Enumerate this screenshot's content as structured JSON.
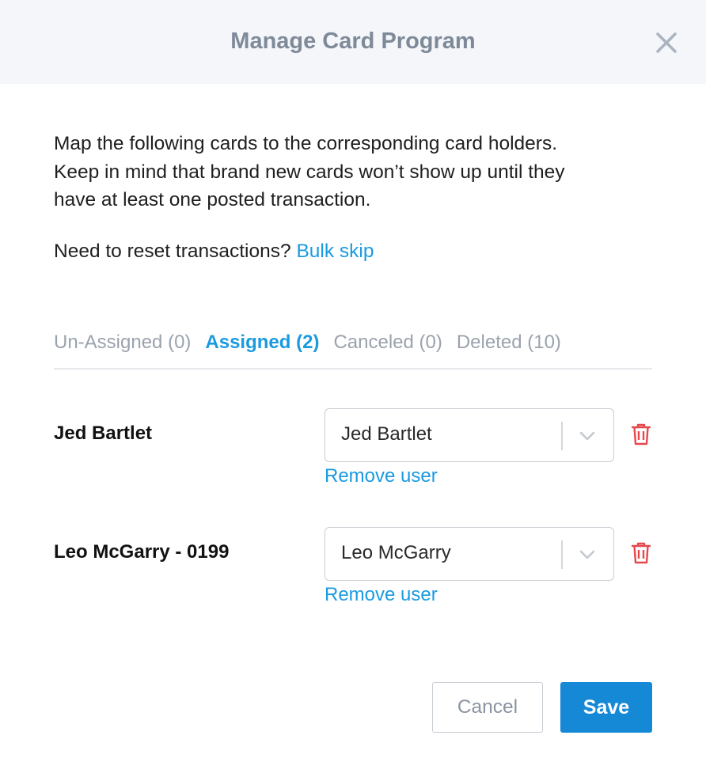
{
  "header": {
    "title": "Manage Card Program",
    "close_icon": "close-icon"
  },
  "intro": {
    "line1": "Map the following cards to the corresponding card holders.",
    "line2": "Keep in mind that brand new cards won’t show up until they",
    "line3": "have at least one posted transaction."
  },
  "reset": {
    "question": "Need to reset transactions?",
    "link": "Bulk skip"
  },
  "tabs": [
    {
      "label": "Un-Assigned (0)",
      "active": false
    },
    {
      "label": "Assigned (2)",
      "active": true
    },
    {
      "label": "Canceled (0)",
      "active": false
    },
    {
      "label": "Deleted (10)",
      "active": false
    }
  ],
  "rows": [
    {
      "card_name": "Jed Bartlet",
      "selected_user": "Jed Bartlet",
      "remove_label": "Remove user",
      "delete_icon": "trash-icon"
    },
    {
      "card_name": "Leo McGarry - 0199",
      "selected_user": "Leo McGarry",
      "remove_label": "Remove user",
      "delete_icon": "trash-icon"
    }
  ],
  "footer": {
    "cancel_label": "Cancel",
    "save_label": "Save"
  },
  "colors": {
    "accent": "#1a9ae0",
    "primary_button": "#1689d6",
    "delete": "#e5484d",
    "header_bg": "#f4f6f9"
  }
}
